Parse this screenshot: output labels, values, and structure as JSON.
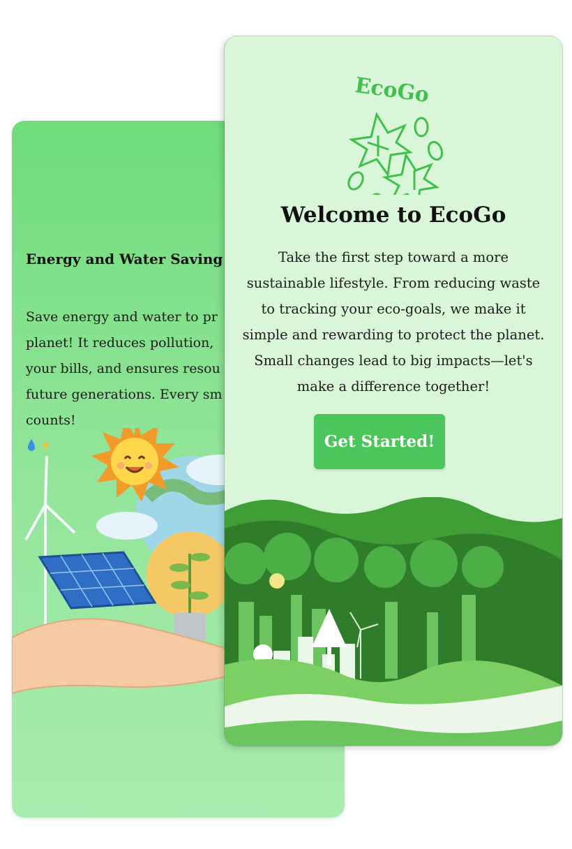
{
  "back_screen": {
    "title": "Energy and Water Saving",
    "body": "Save energy and water to pr\nplanet! It reduces pollution,\nyour bills, and ensures resou\nfuture generations. Every sm\ncounts!",
    "emoji_icons": [
      "water-drop-icon",
      "lightning-icon"
    ],
    "illustration": "sun, solar panel, wind turbine, lightbulb with plant, globe, hand"
  },
  "front_screen": {
    "logo_text": "EcoGo",
    "title": "Welcome to EcoGo",
    "body": "Take the first step toward a more\nsustainable lifestyle. From reducing waste\nto tracking your eco-goals, we make it\nsimple and rewarding to protect the planet.\nSmall changes lead to big impacts—let's\nmake a difference together!",
    "cta_label": "Get Started!"
  },
  "colors": {
    "brand_green": "#4cc65a",
    "logo_green": "#3fbf4c",
    "front_bg": "#d9f7d8",
    "back_bg": "#7ee087"
  }
}
